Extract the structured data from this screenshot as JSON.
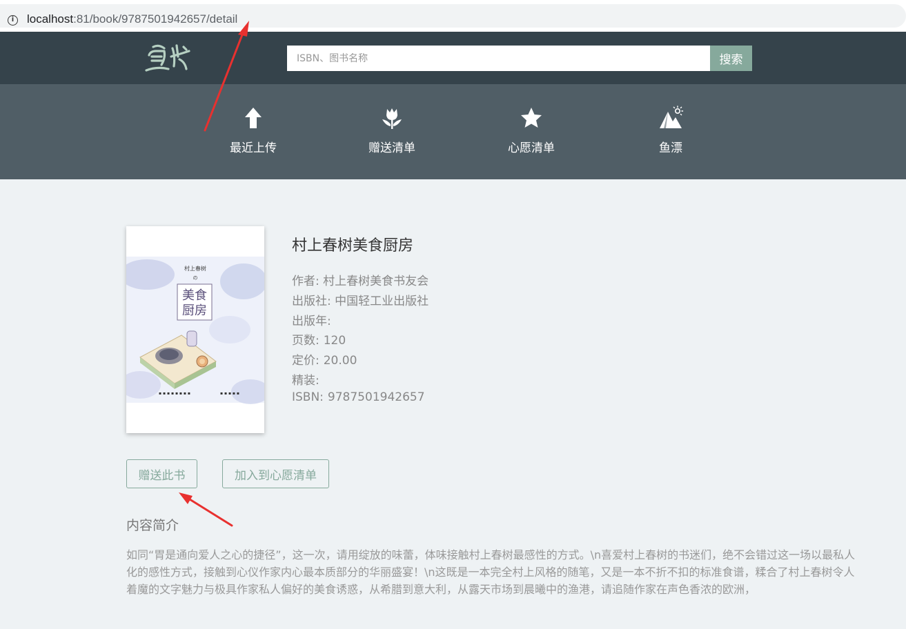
{
  "browser": {
    "url_host": "localhost",
    "url_rest": ":81/book/9787501942657/detail",
    "info_icon": "i"
  },
  "header": {
    "logo_icon": "fish-book-logo",
    "search_placeholder": "ISBN、图书名称",
    "search_button": "搜索"
  },
  "nav": [
    {
      "label": "最近上传",
      "icon": "arrow-up-icon"
    },
    {
      "label": "赠送清单",
      "icon": "tulip-icon"
    },
    {
      "label": "心愿清单",
      "icon": "star-icon"
    },
    {
      "label": "鱼漂",
      "icon": "mountain-sun-icon"
    }
  ],
  "book": {
    "title": "村上春树美食厨房",
    "author_label": "作者:",
    "author": "村上春树美食书友会",
    "publisher_label": "出版社:",
    "publisher": "中国轻工业出版社",
    "pubdate_label": "出版年:",
    "pubdate": "",
    "pages_label": "页数:",
    "pages": "120",
    "price_label": "定价:",
    "price": "20.00",
    "binding_label": "精装:",
    "binding": "",
    "isbn_label": "ISBN:",
    "isbn": "9787501942657",
    "cover": {
      "top_text": "村上春树",
      "no": "の",
      "title_line1": "美食",
      "title_line2": "厨房"
    }
  },
  "actions": {
    "gift": "赠送此书",
    "wish": "加入到心愿清单"
  },
  "summary": {
    "heading": "内容简介",
    "text": "如同“胃是通向爱人之心的捷径”，这一次，请用绽放的味蕾，体味接触村上春树最感性的方式。\\n喜爱村上春树的书迷们，绝不会错过这一场以最私人化的感性方式，接触到心仪作家内心最本质部分的华丽盛宴！\\n这既是一本完全村上风格的随笔，又是一本不折不扣的标准食谱，糅合了村上春树令人着魔的文字魅力与极具作家私人偏好的美食诱惑，从希腊到意大利，从露天市场到晨曦中的渔港，请追随作家在声色香浓的欧洲，"
  },
  "colors": {
    "header": "#35434b",
    "nav": "#505e66",
    "accent": "#86a99c",
    "page_bg": "#eef2f4",
    "annotation": "#e8312f"
  }
}
